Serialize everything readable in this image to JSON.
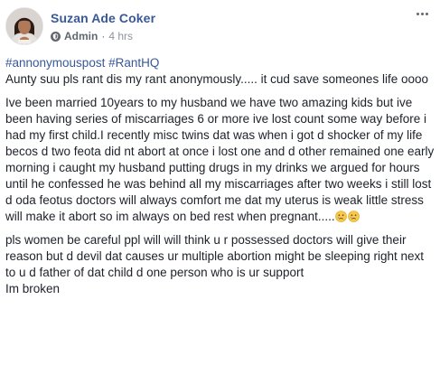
{
  "author": {
    "name": "Suzan Ade Coker",
    "role": "Admin",
    "separator": "·",
    "time": "4 hrs"
  },
  "post": {
    "hashtags": [
      "#annonymouspost",
      "#RantHQ"
    ],
    "paragraph_1": "Aunty suu pls rant dis my rant anonymously..... it cud save someones life oooo",
    "paragraph_2": "Ive been married 10years to my husband we have two amazing kids but ive been having series of miscarriages 6 or more ive lost count some way before i had my first child.I recently misc twins dat was when i got d shocker of my life becos d two feota did nt abort at once i lost one and d other remained one early morning i caught my husband putting drugs in my drinks we argued for hours until he confessed he was behind all my miscarriages after two weeks i still lost d oda feotus doctors will always comfort me dat my uterus is weak little stress will make it abort so im always on bed rest when pregnant.....",
    "paragraph_3": "pls women be careful ppl will will think u r possessed doctors will give their reason but d devil dat causes ur multiple abortion might be sleeping right next to u d father of dat child d one person who is ur support",
    "paragraph_4": "Im broken"
  },
  "icons": {
    "avatar": "profile-photo",
    "admin": "shield-icon",
    "more": "more-options-icon",
    "emoji": "crying-face-emoji"
  },
  "colors": {
    "link": "#385898",
    "text": "#1d2129",
    "meta": "#606770"
  }
}
